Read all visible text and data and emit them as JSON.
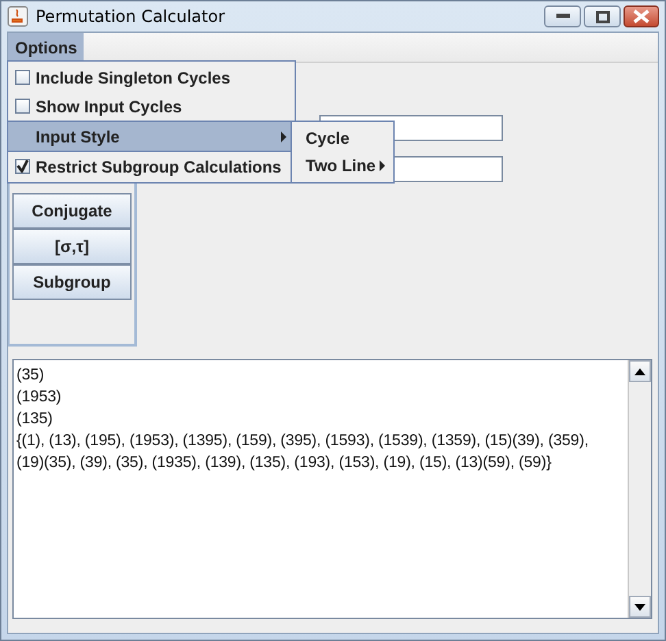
{
  "window": {
    "title": "Permutation Calculator"
  },
  "menu_bar": [
    {
      "label": "Options",
      "selected": true
    }
  ],
  "options_menu": [
    {
      "kind": "checkbox",
      "label": "Include Singleton Cycles",
      "checked": false,
      "selected": false
    },
    {
      "kind": "checkbox",
      "label": "Show Input Cycles",
      "checked": false,
      "selected": false
    },
    {
      "kind": "submenu",
      "label": "Input Style",
      "selected": true
    },
    {
      "kind": "checkbox",
      "label": "Restrict Subgroup Calculations",
      "checked": true,
      "selected": false
    }
  ],
  "input_style_menu": [
    {
      "kind": "item",
      "label": "Cycle"
    },
    {
      "kind": "submenu",
      "label": "Two Line"
    }
  ],
  "buttons": [
    "Conjugate",
    "[σ,τ]",
    "Subgroup"
  ],
  "output_lines": [
    "(35)",
    "(1953)",
    "(135)",
    "{(1), (13), (195), (1953), (1395), (159), (395), (1593), (1539), (1359), (15)(39), (359),",
    "(19)(35), (39), (35), (1935), (139), (135), (193), (153), (19), (15), (13)(59), (59)}"
  ]
}
